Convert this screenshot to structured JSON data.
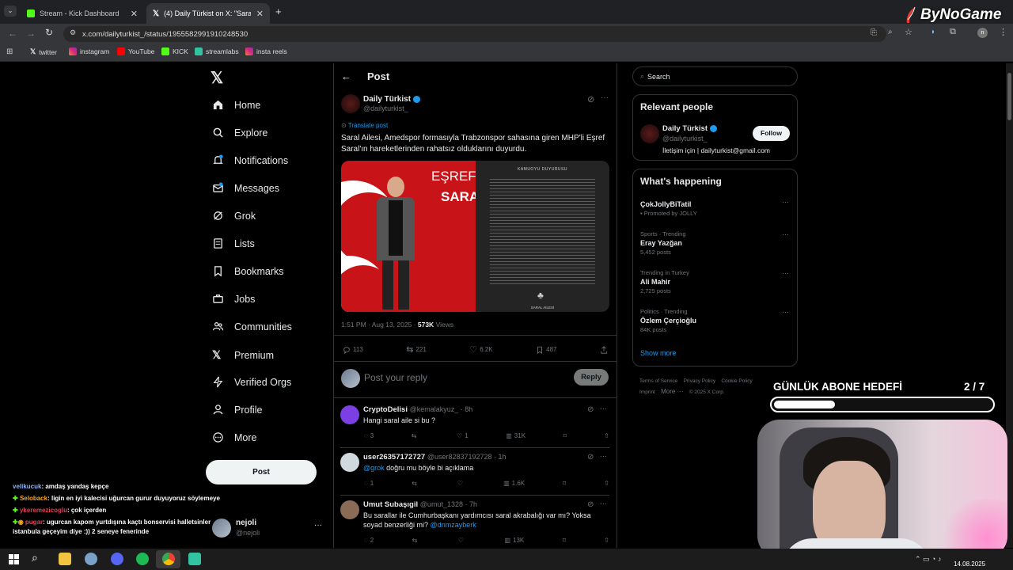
{
  "browser": {
    "tabs": [
      {
        "title": "Stream - Kick Dashboard"
      },
      {
        "title": "(4) Daily Türkist on X: \"Saral Aile"
      }
    ],
    "new_tab_symbol": "+",
    "url": "x.com/dailyturkist_/status/1955582991910248530",
    "bookmarks": [
      "twitter",
      "instagram",
      "YouTube",
      "KICK",
      "streamlabs",
      "insta reels"
    ],
    "profile_initial": "n"
  },
  "overlay": {
    "brand": "ByNoGame",
    "goal_title": "GÜNLÜK ABONE HEDEFİ",
    "goal_count": "2 / 7",
    "goal_progress": 0.28
  },
  "sidebar": {
    "items": [
      {
        "label": "Home",
        "icon": "home-icon"
      },
      {
        "label": "Explore",
        "icon": "search-icon"
      },
      {
        "label": "Notifications",
        "icon": "bell-icon"
      },
      {
        "label": "Messages",
        "icon": "mail-icon"
      },
      {
        "label": "Grok",
        "icon": "grok-icon"
      },
      {
        "label": "Lists",
        "icon": "list-icon"
      },
      {
        "label": "Bookmarks",
        "icon": "bookmark-icon"
      },
      {
        "label": "Jobs",
        "icon": "briefcase-icon"
      },
      {
        "label": "Communities",
        "icon": "people-icon"
      },
      {
        "label": "Premium",
        "icon": "x-logo-icon"
      },
      {
        "label": "Verified Orgs",
        "icon": "bolt-icon"
      },
      {
        "label": "Profile",
        "icon": "person-icon"
      },
      {
        "label": "More",
        "icon": "more-circle-icon"
      }
    ],
    "post_button": "Post",
    "account": {
      "name": "nejoli",
      "handle": "@nejoli"
    }
  },
  "post": {
    "header_title": "Post",
    "author_name": "Daily Türkist",
    "author_handle": "@dailyturkist_",
    "translate": "Translate post",
    "text": "Saral Ailesi, Amedspor formasıyla Trabzonspor sahasına giren MHP'li Eşref Saral'ın hareketlerinden rahatsız olduklarını duyurdu.",
    "image_left_text_1": "EŞREF",
    "image_left_text_2": "SARAL",
    "image_right_title": "KAMUOYU DUYURUSU",
    "image_right_signature": "SARAL AİLESİ",
    "time": "1:51 PM · Aug 13, 2025 · ",
    "views_count": "573K",
    "views_label": " Views",
    "stats": {
      "replies": "113",
      "reposts": "221",
      "likes": "6.2K",
      "bookmarks": "487"
    },
    "reply_placeholder": "Post your reply",
    "reply_button": "Reply"
  },
  "replies": [
    {
      "name": "CryptoDelisi",
      "handle": "@kemalakyuz_ · 8h",
      "text": "Hangi saral aile si bu ?",
      "mention": "",
      "text_after": "",
      "replies": "3",
      "reposts": "",
      "likes": "1",
      "views": "31K"
    },
    {
      "name": "user26357172727",
      "handle": "@user82837192728 · 1h",
      "text": "",
      "mention": "@grok",
      "text_after": " doğru mu böyle bi açıklama",
      "replies": "1",
      "reposts": "",
      "likes": "",
      "views": "1.6K"
    },
    {
      "name": "Umut Subaşıgil",
      "handle": "@umut_1328 · 7h",
      "text": "Bu sarallar ile Cumhurbaşkanı yardımcısı saral akrabalığı var mı? Yoksa soyad benzerliği mi? ",
      "mention": "@dnmzayberk",
      "text_after": "",
      "replies": "2",
      "reposts": "",
      "likes": "",
      "views": "13K"
    }
  ],
  "right": {
    "search_placeholder": "Search",
    "relevant_title": "Relevant people",
    "person_name": "Daily Türkist",
    "person_handle": "@dailyturkist_",
    "person_bio": "İletişim için | dailyturkist@gmail.com",
    "follow": "Follow",
    "happening_title": "What's happening",
    "trends": [
      {
        "category": "",
        "name": "ÇokJollyBiTatil",
        "posts": "Promoted by JOLLY"
      },
      {
        "category": "Sports · Trending",
        "name": "Eray Yazğan",
        "posts": "5,452 posts"
      },
      {
        "category": "Trending in Turkey",
        "name": "Ali Mahir",
        "posts": "2,725 posts"
      },
      {
        "category": "Politics · Trending",
        "name": "Özlem Çerçioğlu",
        "posts": "84K posts"
      }
    ],
    "show_more": "Show more",
    "footer": [
      "Terms of Service",
      "Privacy Policy",
      "Cookie Policy",
      "Imprint",
      "More ···",
      "© 2025 X Corp."
    ]
  },
  "chat": [
    {
      "user": "velikucuk",
      "color": "#8ab4f8",
      "message": ": amdaş yandaş kepçe"
    },
    {
      "user": "Seloback",
      "color": "#f5a623",
      "message": ": ligin en iyi kalecisi uğurcan gurur duyuyoruz söylemeye"
    },
    {
      "user": "ykeremezicoglu",
      "color": "#e0405a",
      "message": ": çok içerden"
    },
    {
      "user": "pugar",
      "color": "#e0405a",
      "message": ": ugurcan kapom yurtdışına kaçtı bonservisi halletsinler"
    },
    {
      "user": "",
      "color": "#ffffff",
      "message": "istanbula geçeyim diye :)) 2 seneye fenerinde"
    }
  ],
  "taskbar": {
    "date": "14.08.2025"
  }
}
